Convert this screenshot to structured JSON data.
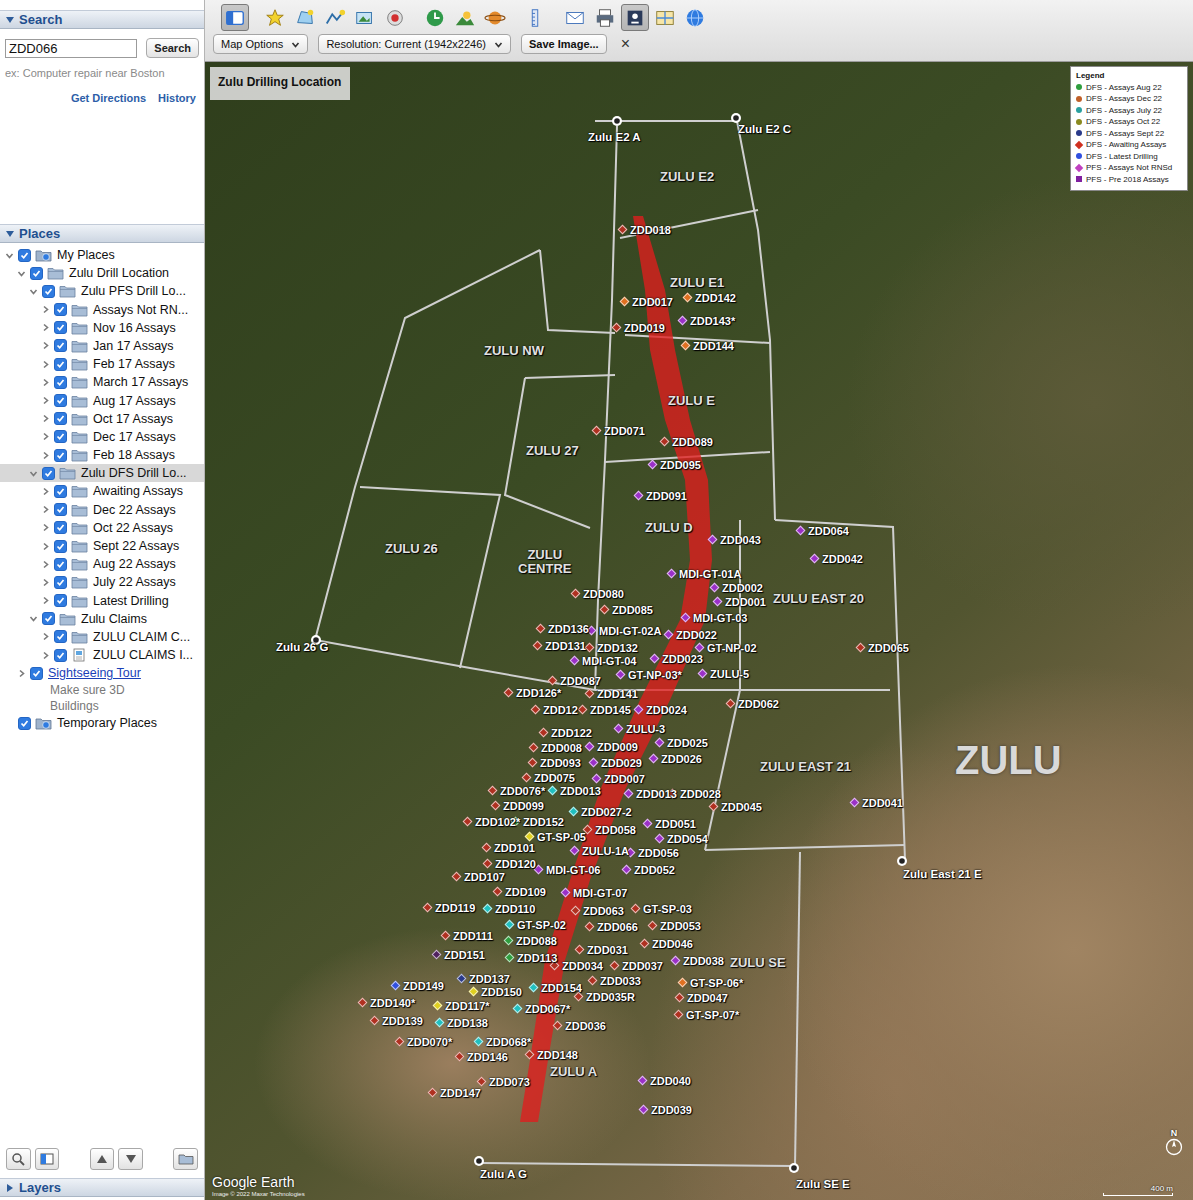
{
  "sidebar": {
    "search": {
      "header": "Search",
      "expanded": true,
      "value": "ZDD066",
      "button": "Search",
      "hint": "ex: Computer repair near Boston",
      "links": [
        "Get Directions",
        "History"
      ]
    },
    "places": {
      "header": "Places",
      "expanded": true,
      "items": [
        {
          "label": "My Places",
          "level": 0,
          "kind": "places",
          "expanded": true,
          "checked": true,
          "selected": false
        },
        {
          "label": "Zulu Drill Location",
          "level": 1,
          "kind": "folder",
          "expanded": true,
          "checked": true,
          "selected": false
        },
        {
          "label": "Zulu PFS Drill Lo...",
          "level": 2,
          "kind": "folder",
          "expanded": true,
          "checked": true,
          "selected": false
        },
        {
          "label": "Assays Not RN...",
          "level": 3,
          "kind": "folder",
          "expanded": false,
          "checked": true,
          "selected": false
        },
        {
          "label": "Nov 16 Assays",
          "level": 3,
          "kind": "folder",
          "expanded": false,
          "checked": true,
          "selected": false
        },
        {
          "label": "Jan 17 Assays",
          "level": 3,
          "kind": "folder",
          "expanded": false,
          "checked": true,
          "selected": false
        },
        {
          "label": "Feb 17 Assays",
          "level": 3,
          "kind": "folder",
          "expanded": false,
          "checked": true,
          "selected": false
        },
        {
          "label": "March 17 Assays",
          "level": 3,
          "kind": "folder",
          "expanded": false,
          "checked": true,
          "selected": false
        },
        {
          "label": "Aug 17 Assays",
          "level": 3,
          "kind": "folder",
          "expanded": false,
          "checked": true,
          "selected": false
        },
        {
          "label": "Oct 17 Assays",
          "level": 3,
          "kind": "folder",
          "expanded": false,
          "checked": true,
          "selected": false
        },
        {
          "label": "Dec 17 Assays",
          "level": 3,
          "kind": "folder",
          "expanded": false,
          "checked": true,
          "selected": false
        },
        {
          "label": "Feb 18 Assays",
          "level": 3,
          "kind": "folder",
          "expanded": false,
          "checked": true,
          "selected": false
        },
        {
          "label": "Zulu DFS Drill Lo...",
          "level": 2,
          "kind": "folder",
          "expanded": true,
          "checked": true,
          "selected": true
        },
        {
          "label": "Awaiting Assays",
          "level": 3,
          "kind": "folder",
          "expanded": false,
          "checked": true,
          "selected": false
        },
        {
          "label": "Dec 22 Assays",
          "level": 3,
          "kind": "folder",
          "expanded": false,
          "checked": true,
          "selected": false
        },
        {
          "label": "Oct 22 Assays",
          "level": 3,
          "kind": "folder",
          "expanded": false,
          "checked": true,
          "selected": false
        },
        {
          "label": "Sept 22 Assays",
          "level": 3,
          "kind": "folder",
          "expanded": false,
          "checked": true,
          "selected": false
        },
        {
          "label": "Aug 22 Assays",
          "level": 3,
          "kind": "folder",
          "expanded": false,
          "checked": true,
          "selected": false
        },
        {
          "label": "July 22 Assays",
          "level": 3,
          "kind": "folder",
          "expanded": false,
          "checked": true,
          "selected": false
        },
        {
          "label": "Latest Drilling",
          "level": 3,
          "kind": "folder",
          "expanded": false,
          "checked": true,
          "selected": false
        },
        {
          "label": "Zulu Claims",
          "level": 2,
          "kind": "folder",
          "expanded": true,
          "checked": true,
          "selected": false
        },
        {
          "label": "ZULU CLAIM C...",
          "level": 3,
          "kind": "folder",
          "expanded": false,
          "checked": true,
          "selected": false
        },
        {
          "label": "ZULU CLAIMS I...",
          "level": 3,
          "kind": "layer",
          "expanded": false,
          "checked": true,
          "selected": false
        },
        {
          "label": "Sightseeing Tour",
          "level": 1,
          "kind": "tour",
          "expanded": false,
          "checked": true,
          "selected": false,
          "note": "Make sure 3D Buildings"
        },
        {
          "label": "Temporary Places",
          "level": 0,
          "kind": "places-plain",
          "checked": true,
          "selected": false
        }
      ]
    },
    "layers": {
      "header": "Layers",
      "expanded": false
    }
  },
  "toolbar": {
    "tools": [
      {
        "selected": true
      },
      {
        "selected": false
      },
      {
        "selected": false
      },
      {
        "selected": false
      },
      {
        "selected": false
      },
      {
        "selected": false
      },
      {
        "selected": false
      },
      {
        "selected": false
      },
      {
        "selected": false
      },
      {
        "selected": false
      },
      {
        "selected": false
      },
      {
        "selected": false
      },
      {
        "selected": true
      },
      {
        "selected": false
      },
      {
        "selected": false
      }
    ],
    "map_options": "Map Options",
    "resolution": "Resolution: Current (1942x2246)",
    "save": "Save Image...",
    "close": "×"
  },
  "map": {
    "title": "Zulu Drilling Location",
    "legend": {
      "title": "Legend",
      "items": [
        {
          "label": "DFS - Assays Aug 22",
          "color": "#2e9e3e",
          "kind": "dot"
        },
        {
          "label": "DFS - Assays Dec 22",
          "color": "#c0602a",
          "kind": "dot"
        },
        {
          "label": "DFS - Assays July 22",
          "color": "#2aa0a0",
          "kind": "dot"
        },
        {
          "label": "DFS - Assays Oct 22",
          "color": "#8a8a20",
          "kind": "dot"
        },
        {
          "label": "DFS - Assays Sept 22",
          "color": "#2a3a8a",
          "kind": "dot"
        },
        {
          "label": "DFS - Awaiting Assays",
          "color": "#d03020",
          "kind": "diamond"
        },
        {
          "label": "DFS - Latest Drilling",
          "color": "#3050e0",
          "kind": "dot"
        },
        {
          "label": "PFS - Assays Not RNSd",
          "color": "#c040c0",
          "kind": "diamond"
        },
        {
          "label": "PFS - Pre 2018 Assays",
          "color": "#8020a0",
          "kind": "square"
        }
      ]
    },
    "claims": [
      "ZULU E2",
      "ZULU E1",
      "ZULU NW",
      "ZULU E",
      "ZULU 27",
      "ZULU 26",
      "ZULU CENTRE",
      "ZULU D",
      "ZULU EAST 20",
      "ZULU EAST 21",
      "ZULU SE",
      "ZULU A"
    ],
    "region": "ZULU",
    "corners": [
      "Zulu E2 A",
      "Zulu E2 C",
      "Zulu 26 G",
      "Zulu East 21 E",
      "Zulu A G",
      "Zulu SE E"
    ],
    "holes": [
      {
        "label": "ZDD018",
        "color": "#b03020"
      },
      {
        "label": "ZDD142",
        "color": "#e07020"
      },
      {
        "label": "ZDD017",
        "color": "#e07020"
      },
      {
        "label": "ZDD143*",
        "color": "#9b30c8"
      },
      {
        "label": "ZDD019",
        "color": "#b03020"
      },
      {
        "label": "ZDD144",
        "color": "#e07020"
      },
      {
        "label": "ZDD071",
        "color": "#b03020"
      },
      {
        "label": "ZDD089",
        "color": "#b03020"
      },
      {
        "label": "ZDD095",
        "color": "#9b30c8"
      },
      {
        "label": "ZDD091",
        "color": "#9b30c8"
      },
      {
        "label": "ZDD043",
        "color": "#9b30c8"
      },
      {
        "label": "ZDD064",
        "color": "#9b30c8"
      },
      {
        "label": "ZDD042",
        "color": "#9b30c8"
      },
      {
        "label": "MDI-GT-01A",
        "color": "#9b30c8"
      },
      {
        "label": "ZDD002",
        "color": "#9b30c8"
      },
      {
        "label": "ZDD001",
        "color": "#9b30c8"
      },
      {
        "label": "ZDD080",
        "color": "#b03020"
      },
      {
        "label": "ZDD085",
        "color": "#b03020"
      },
      {
        "label": "MDI-GT-03",
        "color": "#9b30c8"
      },
      {
        "label": "ZDD136",
        "color": "#b03020"
      },
      {
        "label": "MDI-GT-02A",
        "color": "#9b30c8"
      },
      {
        "label": "ZDD022",
        "color": "#9b30c8"
      },
      {
        "label": "ZDD131",
        "color": "#b03020"
      },
      {
        "label": "ZDD132",
        "color": "#b03020"
      },
      {
        "label": "GT-NP-02",
        "color": "#9b30c8"
      },
      {
        "label": "ZDD065",
        "color": "#b03020"
      },
      {
        "label": "MDI-GT-04",
        "color": "#9b30c8"
      },
      {
        "label": "ZDD023",
        "color": "#9b30c8"
      },
      {
        "label": "ZULU-5",
        "color": "#9b30c8"
      },
      {
        "label": "GT-NP-03*",
        "color": "#9b30c8"
      },
      {
        "label": "ZDD087",
        "color": "#b03020"
      },
      {
        "label": "ZDD126*",
        "color": "#b03020"
      },
      {
        "label": "ZDD141",
        "color": "#b03020"
      },
      {
        "label": "ZDD062",
        "color": "#b03020"
      },
      {
        "label": "ZDD12",
        "color": "#b03020"
      },
      {
        "label": "ZDD145",
        "color": "#b03020"
      },
      {
        "label": "ZDD024",
        "color": "#9b30c8"
      },
      {
        "label": "ZULU-3",
        "color": "#9b30c8"
      },
      {
        "label": "ZDD122",
        "color": "#b03020"
      },
      {
        "label": "ZDD008",
        "color": "#b03020"
      },
      {
        "label": "ZDD009",
        "color": "#9b30c8"
      },
      {
        "label": "ZDD025",
        "color": "#9b30c8"
      },
      {
        "label": "ZDD093",
        "color": "#b03020"
      },
      {
        "label": "ZDD029",
        "color": "#9b30c8"
      },
      {
        "label": "ZDD026",
        "color": "#9b30c8"
      },
      {
        "label": "ZDD075",
        "color": "#b03020"
      },
      {
        "label": "ZDD007",
        "color": "#9b30c8"
      },
      {
        "label": "ZDD076*",
        "color": "#b03020"
      },
      {
        "label": "ZDD013",
        "color": "#20c0c0"
      },
      {
        "label": "ZDD013",
        "color": "#9b30c8"
      },
      {
        "label": "ZDD028",
        "color": "#b03020"
      },
      {
        "label": "ZDD045",
        "color": "#b03020"
      },
      {
        "label": "ZDD041",
        "color": "#9b30c8"
      },
      {
        "label": "ZDD099",
        "color": "#b03020"
      },
      {
        "label": "ZDD027-2",
        "color": "#20c0c0"
      },
      {
        "label": "ZDD102*",
        "color": "#b03020"
      },
      {
        "label": "ZDD152",
        "color": "#2e9e3e"
      },
      {
        "label": "ZDD051",
        "color": "#9b30c8"
      },
      {
        "label": "ZDD058",
        "color": "#b03020"
      },
      {
        "label": "GT-SP-05",
        "color": "#e0d020"
      },
      {
        "label": "ZDD054",
        "color": "#9b30c8"
      },
      {
        "label": "ZDD101",
        "color": "#b03020"
      },
      {
        "label": "ZULU-1A",
        "color": "#9b30c8"
      },
      {
        "label": "ZDD056",
        "color": "#9b30c8"
      },
      {
        "label": "ZDD120",
        "color": "#b03020"
      },
      {
        "label": "MDI-GT-06",
        "color": "#9b30c8"
      },
      {
        "label": "ZDD052",
        "color": "#9b30c8"
      },
      {
        "label": "ZDD107",
        "color": "#b03020"
      },
      {
        "label": "ZDD109",
        "color": "#b03020"
      },
      {
        "label": "MDI-GT-07",
        "color": "#9b30c8"
      },
      {
        "label": "ZDD119",
        "color": "#b03020"
      },
      {
        "label": "ZDD110",
        "color": "#20c0c0"
      },
      {
        "label": "ZDD063",
        "color": "#b03020"
      },
      {
        "label": "GT-SP-03",
        "color": "#b03020"
      },
      {
        "label": "GT-SP-02",
        "color": "#20c0c0"
      },
      {
        "label": "ZDD066",
        "color": "#b03020"
      },
      {
        "label": "ZDD053",
        "color": "#b03020"
      },
      {
        "label": "ZDD111",
        "color": "#b03020"
      },
      {
        "label": "ZDD088",
        "color": "#2e9e3e"
      },
      {
        "label": "ZDD046",
        "color": "#b03020"
      },
      {
        "label": "ZDD031",
        "color": "#b03020"
      },
      {
        "label": "ZDD151",
        "color": "#502060"
      },
      {
        "label": "ZDD113",
        "color": "#2e9e3e"
      },
      {
        "label": "ZDD038",
        "color": "#9b30c8"
      },
      {
        "label": "ZDD034",
        "color": "#b03020"
      },
      {
        "label": "ZDD037",
        "color": "#b03020"
      },
      {
        "label": "ZDD137",
        "color": "#2a3a8a"
      },
      {
        "label": "ZDD033",
        "color": "#b03020"
      },
      {
        "label": "GT-SP-06*",
        "color": "#e07020"
      },
      {
        "label": "ZDD149",
        "color": "#3050e0"
      },
      {
        "label": "ZDD154",
        "color": "#20c0c0"
      },
      {
        "label": "ZDD150",
        "color": "#e0d020"
      },
      {
        "label": "ZDD035R",
        "color": "#b03020"
      },
      {
        "label": "ZDD047",
        "color": "#b03020"
      },
      {
        "label": "ZDD140*",
        "color": "#b03020"
      },
      {
        "label": "ZDD117*",
        "color": "#e0d020"
      },
      {
        "label": "ZDD067*",
        "color": "#20c0c0"
      },
      {
        "label": "GT-SP-07*",
        "color": "#b03020"
      },
      {
        "label": "ZDD139",
        "color": "#b03020"
      },
      {
        "label": "ZDD138",
        "color": "#20c0c0"
      },
      {
        "label": "ZDD036",
        "color": "#b03020"
      },
      {
        "label": "ZDD070*",
        "color": "#b03020"
      },
      {
        "label": "ZDD068*",
        "color": "#20c0c0"
      },
      {
        "label": "ZDD146",
        "color": "#b03020"
      },
      {
        "label": "ZDD148",
        "color": "#b03020"
      },
      {
        "label": "ZDD040",
        "color": "#9b30c8"
      },
      {
        "label": "ZDD073",
        "color": "#b03020"
      },
      {
        "label": "ZDD147",
        "color": "#b03020"
      },
      {
        "label": "ZDD039",
        "color": "#9b30c8"
      }
    ],
    "attribution": "Google Earth",
    "imagery": "Image © 2022 Maxar Technologies",
    "scale": "400 m",
    "compass": "N"
  }
}
